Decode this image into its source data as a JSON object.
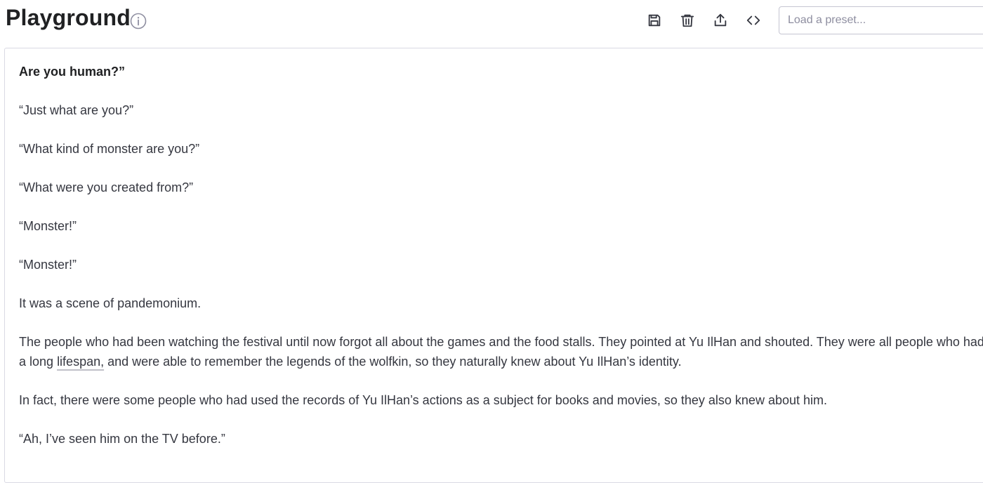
{
  "header": {
    "title": "Playground",
    "info_icon": "info-icon"
  },
  "toolbar": {
    "buttons": [
      {
        "icon": "save-icon"
      },
      {
        "icon": "trash-icon"
      },
      {
        "icon": "share-icon"
      },
      {
        "icon": "code-icon"
      }
    ],
    "preset_placeholder": "Load a preset..."
  },
  "editor": {
    "paragraphs": [
      "Are you human?”",
      "“Just what are you?”",
      "“What kind of monster are you?”",
      "“What were you created from?”",
      "“Monster!”",
      "“Monster!”",
      "It was a scene of pandemonium.",
      "The people who had been watching the festival until now forgot all about the games and the food stalls. They pointed at Yu IlHan and shouted. They were all people who had a long",
      "lifespan,",
      " and were able to remember the legends of the wolfkin, so they naturally knew about Yu IlHan’s identity.",
      "In fact, there were some people who had used the records of Yu IlHan’s actions as a subject for books and movies, so they also knew about him.",
      "“Ah, I’ve seen him on the TV before.”"
    ]
  }
}
